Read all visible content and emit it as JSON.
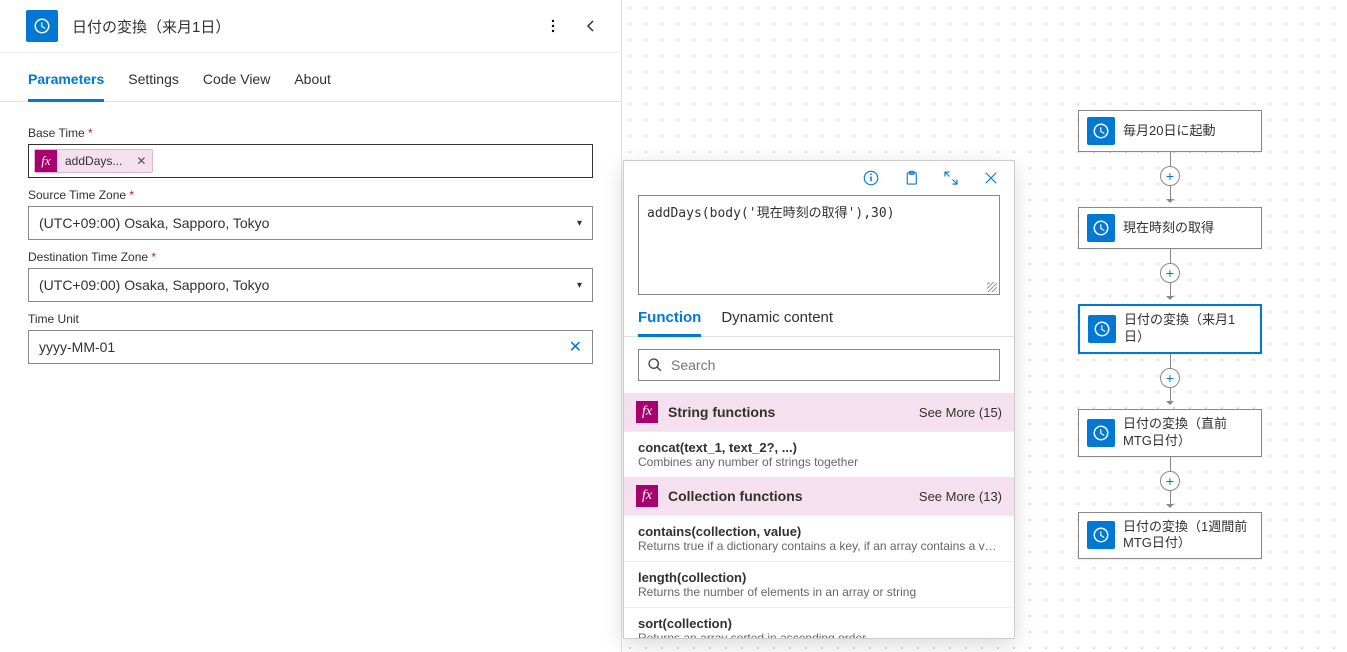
{
  "panel": {
    "title": "日付の変換（来月1日）",
    "tabs": [
      "Parameters",
      "Settings",
      "Code View",
      "About"
    ],
    "active_tab": 0
  },
  "fields": {
    "base_time": {
      "label": "Base Time",
      "required": true,
      "token_text": "addDays..."
    },
    "source_tz": {
      "label": "Source Time Zone",
      "required": true,
      "value": "(UTC+09:00) Osaka, Sapporo, Tokyo"
    },
    "dest_tz": {
      "label": "Destination Time Zone",
      "required": true,
      "value": "(UTC+09:00) Osaka, Sapporo, Tokyo"
    },
    "time_unit": {
      "label": "Time Unit",
      "required": false,
      "value": "yyyy-MM-01"
    }
  },
  "expression": {
    "value": "addDays(body('現在時刻の取得'),30)",
    "tabs": [
      "Function",
      "Dynamic content"
    ],
    "active_tab": 0,
    "search_placeholder": "Search",
    "categories": [
      {
        "name": "String functions",
        "see_more": "See More (15)",
        "items": [
          {
            "sig": "concat(text_1, text_2?, ...)",
            "desc": "Combines any number of strings together"
          }
        ]
      },
      {
        "name": "Collection functions",
        "see_more": "See More (13)",
        "items": [
          {
            "sig": "contains(collection, value)",
            "desc": "Returns true if a dictionary contains a key, if an array contains a val..."
          },
          {
            "sig": "length(collection)",
            "desc": "Returns the number of elements in an array or string"
          },
          {
            "sig": "sort(collection)",
            "desc": "Returns an array sorted in ascending order"
          }
        ]
      }
    ]
  },
  "flow": [
    {
      "label": "毎月20日に起動",
      "active": false
    },
    {
      "label": "現在時刻の取得",
      "active": false
    },
    {
      "label": "日付の変換（来月1日）",
      "active": true
    },
    {
      "label": "日付の変換（直前MTG日付）",
      "active": false
    },
    {
      "label": "日付の変換（1週間前MTG日付）",
      "active": false
    }
  ]
}
